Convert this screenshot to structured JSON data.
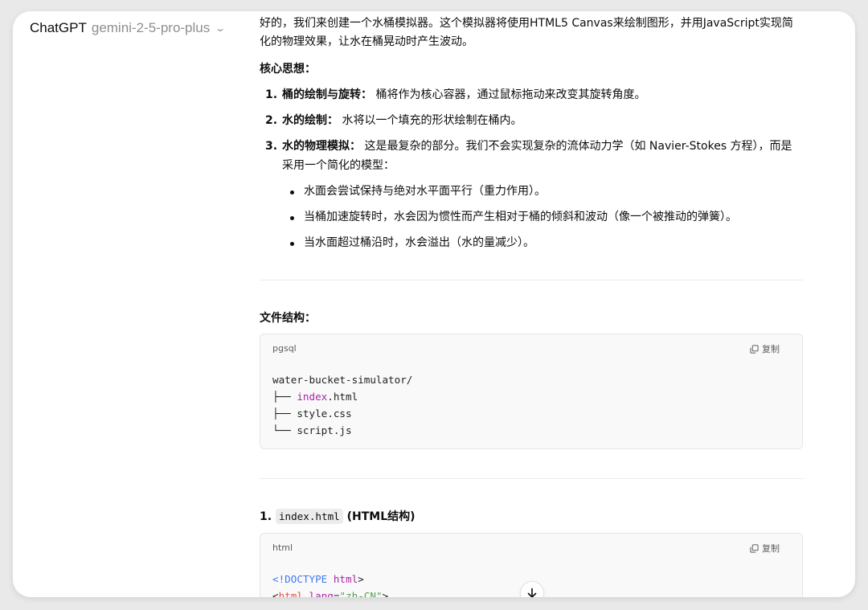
{
  "header": {
    "brand": "ChatGPT",
    "model": "gemini-2-5-pro-plus",
    "chevron_icon": "chevron-down-icon"
  },
  "message": {
    "intro": "好的，我们来创建一个水桶模拟器。这个模拟器将使用HTML5 Canvas来绘制图形，并用JavaScript实现简化的物理效果，让水在桶晃动时产生波动。",
    "core_heading": "核心思想：",
    "core_items": [
      {
        "num": "1.",
        "title": "桶的绘制与旋转：",
        "text": " 桶将作为核心容器，通过鼠标拖动来改变其旋转角度。"
      },
      {
        "num": "2.",
        "title": "水的绘制：",
        "text": " 水将以一个填充的形状绘制在桶内。"
      },
      {
        "num": "3.",
        "title": "水的物理模拟：",
        "text": " 这是最复杂的部分。我们不会实现复杂的流体动力学（如 Navier-Stokes 方程），而是采用一个简化的模型："
      }
    ],
    "sub_items": [
      "水面会尝试保持与绝对水平面平行（重力作用）。",
      "当桶加速旋转时，水会因为惯性而产生相对于桶的倾斜和波动（像一个被推动的弹簧）。",
      "当水面超过桶沿时，水会溢出（水的量减少）。"
    ],
    "file_structure_heading": "文件结构：",
    "file_structure_block": {
      "lang": "pgsql",
      "copy_label": "复制",
      "lines": [
        [
          {
            "t": "water-bucket-simulator/",
            "c": ""
          }
        ],
        [
          {
            "t": "├── ",
            "c": ""
          },
          {
            "t": "index",
            "c": "purple"
          },
          {
            "t": ".html",
            "c": ""
          }
        ],
        [
          {
            "t": "├── style.css",
            "c": ""
          }
        ],
        [
          {
            "t": "└── script.js",
            "c": ""
          }
        ]
      ]
    },
    "section1_num": "1.",
    "section1_code": "index.html",
    "section1_suffix": "(HTML结构)",
    "html_block": {
      "lang": "html",
      "copy_label": "复制",
      "lines": [
        [
          {
            "t": "<!DOCTYPE ",
            "c": "blue"
          },
          {
            "t": "html",
            "c": "purple"
          },
          {
            "t": ">",
            "c": ""
          }
        ],
        [
          {
            "t": "<",
            "c": ""
          },
          {
            "t": "html",
            "c": "red"
          },
          {
            "t": " ",
            "c": ""
          },
          {
            "t": "lang",
            "c": "purple"
          },
          {
            "t": "=",
            "c": ""
          },
          {
            "t": "\"zh-CN\"",
            "c": "green"
          },
          {
            "t": ">",
            "c": ""
          }
        ]
      ]
    }
  },
  "scroll_button_icon": "arrow-down-icon"
}
